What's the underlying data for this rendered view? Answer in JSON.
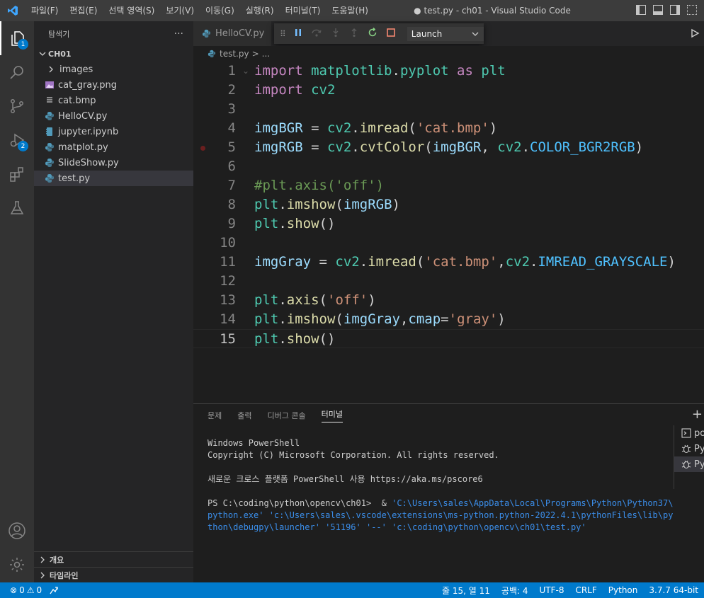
{
  "titlebar": {
    "menu": [
      "파일(F)",
      "편집(E)",
      "선택 영역(S)",
      "보기(V)",
      "이동(G)",
      "실행(R)",
      "터미널(T)",
      "도움말(H)"
    ],
    "window_title": "● test.py - ch01 - Visual Studio Code"
  },
  "activitybar": {
    "explorer_badge": "1",
    "debug_badge": "2"
  },
  "sidebar": {
    "title": "탐색기",
    "more": "···",
    "folder": "CH01",
    "items": [
      {
        "label": "images",
        "icon": "chevron-right-icon",
        "kind": "folder"
      },
      {
        "label": "cat_gray.png",
        "icon": "image-file-icon",
        "kind": "file"
      },
      {
        "label": "cat.bmp",
        "icon": "file-icon",
        "kind": "file"
      },
      {
        "label": "HelloCV.py",
        "icon": "python-icon",
        "kind": "file"
      },
      {
        "label": "jupyter.ipynb",
        "icon": "notebook-icon",
        "kind": "file"
      },
      {
        "label": "matplot.py",
        "icon": "python-icon",
        "kind": "file"
      },
      {
        "label": "SlideShow.py",
        "icon": "python-icon",
        "kind": "file"
      },
      {
        "label": "test.py",
        "icon": "python-icon",
        "kind": "file",
        "selected": true
      }
    ],
    "outline": "개요",
    "timeline": "타임라인"
  },
  "tabs": {
    "open_tab": "HelloCV.py",
    "debug_config": "Launch"
  },
  "breadcrumb": {
    "file": "test.py",
    "sep": ">",
    "more": "..."
  },
  "editor": {
    "current_line": 15,
    "breakpoint_line": 5,
    "lines": [
      {
        "n": "1",
        "tokens": [
          [
            "kw",
            "import"
          ],
          [
            "pl",
            " "
          ],
          [
            "mod",
            "matplotlib"
          ],
          [
            "pl",
            "."
          ],
          [
            "mod",
            "pyplot"
          ],
          [
            "pl",
            " "
          ],
          [
            "kw",
            "as"
          ],
          [
            "pl",
            " "
          ],
          [
            "mod",
            "plt"
          ]
        ]
      },
      {
        "n": "2",
        "tokens": [
          [
            "kw",
            "import"
          ],
          [
            "pl",
            " "
          ],
          [
            "mod",
            "cv2"
          ]
        ]
      },
      {
        "n": "3",
        "tokens": []
      },
      {
        "n": "4",
        "tokens": [
          [
            "id",
            "imgBGR"
          ],
          [
            "pl",
            " = "
          ],
          [
            "mod",
            "cv2"
          ],
          [
            "pl",
            "."
          ],
          [
            "fn",
            "imread"
          ],
          [
            "pl",
            "("
          ],
          [
            "str",
            "'cat.bmp'"
          ],
          [
            "pl",
            ")"
          ]
        ]
      },
      {
        "n": "5",
        "tokens": [
          [
            "id",
            "imgRGB"
          ],
          [
            "pl",
            " = "
          ],
          [
            "mod",
            "cv2"
          ],
          [
            "pl",
            "."
          ],
          [
            "fn",
            "cvtColor"
          ],
          [
            "pl",
            "("
          ],
          [
            "id",
            "imgBGR"
          ],
          [
            "pl",
            ", "
          ],
          [
            "mod",
            "cv2"
          ],
          [
            "pl",
            "."
          ],
          [
            "cst",
            "COLOR_BGR2RGB"
          ],
          [
            "pl",
            ")"
          ]
        ]
      },
      {
        "n": "6",
        "tokens": []
      },
      {
        "n": "7",
        "tokens": [
          [
            "cm",
            "#plt.axis('off')"
          ]
        ]
      },
      {
        "n": "8",
        "tokens": [
          [
            "mod",
            "plt"
          ],
          [
            "pl",
            "."
          ],
          [
            "fn",
            "imshow"
          ],
          [
            "pl",
            "("
          ],
          [
            "id",
            "imgRGB"
          ],
          [
            "pl",
            ")"
          ]
        ]
      },
      {
        "n": "9",
        "tokens": [
          [
            "mod",
            "plt"
          ],
          [
            "pl",
            "."
          ],
          [
            "fn",
            "show"
          ],
          [
            "pl",
            "()"
          ]
        ]
      },
      {
        "n": "10",
        "tokens": []
      },
      {
        "n": "11",
        "tokens": [
          [
            "id",
            "imgGray"
          ],
          [
            "pl",
            " = "
          ],
          [
            "mod",
            "cv2"
          ],
          [
            "pl",
            "."
          ],
          [
            "fn",
            "imread"
          ],
          [
            "pl",
            "("
          ],
          [
            "str",
            "'cat.bmp'"
          ],
          [
            "pl",
            ","
          ],
          [
            "mod",
            "cv2"
          ],
          [
            "pl",
            "."
          ],
          [
            "cst",
            "IMREAD_GRAYSCALE"
          ],
          [
            "pl",
            ")"
          ]
        ]
      },
      {
        "n": "12",
        "tokens": []
      },
      {
        "n": "13",
        "tokens": [
          [
            "mod",
            "plt"
          ],
          [
            "pl",
            "."
          ],
          [
            "fn",
            "axis"
          ],
          [
            "pl",
            "("
          ],
          [
            "str",
            "'off'"
          ],
          [
            "pl",
            ")"
          ]
        ]
      },
      {
        "n": "14",
        "tokens": [
          [
            "mod",
            "plt"
          ],
          [
            "pl",
            "."
          ],
          [
            "fn",
            "imshow"
          ],
          [
            "pl",
            "("
          ],
          [
            "id",
            "imgGray"
          ],
          [
            "pl",
            ","
          ],
          [
            "id",
            "cmap"
          ],
          [
            "pl",
            "="
          ],
          [
            "str",
            "'gray'"
          ],
          [
            "pl",
            ")"
          ]
        ]
      },
      {
        "n": "15",
        "tokens": [
          [
            "mod",
            "plt"
          ],
          [
            "pl",
            "."
          ],
          [
            "fn",
            "show"
          ],
          [
            "pl",
            "()"
          ]
        ]
      }
    ]
  },
  "panel": {
    "tabs": [
      "문제",
      "출력",
      "디버그 콘솔",
      "터미널"
    ],
    "active_tab": "터미널",
    "terminal": {
      "line1": "Windows PowerShell",
      "line2": "Copyright (C) Microsoft Corporation. All rights reserved.",
      "line3": "새로운 크로스 플랫폼 PowerShell 사용 https://aka.ms/pscore6",
      "prompt": "PS C:\\coding\\python\\opencv\\ch01>  & ",
      "cmd1": "'C:\\Users\\sales\\AppData\\Local\\Programs\\Python\\Python37\\",
      "cmd2": "python.exe' 'c:\\Users\\sales\\.vscode\\extensions\\ms-python.python-2022.4.1\\pythonFiles\\lib\\py",
      "cmd3": "thon\\debugpy\\launcher' '51196' '--' 'c:\\coding\\python\\opencv\\ch01\\test.py'"
    },
    "terminal_list": [
      "pow",
      "Py",
      "Py"
    ]
  },
  "statusbar": {
    "errors": "0",
    "warnings": "0",
    "position": "줄 15, 열 11",
    "spaces": "공백: 4",
    "encoding": "UTF-8",
    "eol": "CRLF",
    "language": "Python",
    "interpreter": "3.7.7 64-bit"
  },
  "colors": {
    "accent": "#007acc",
    "titlebar": "#3c3c3c",
    "activitybar": "#333333",
    "sidebar": "#252526",
    "editor": "#1e1e1e"
  }
}
